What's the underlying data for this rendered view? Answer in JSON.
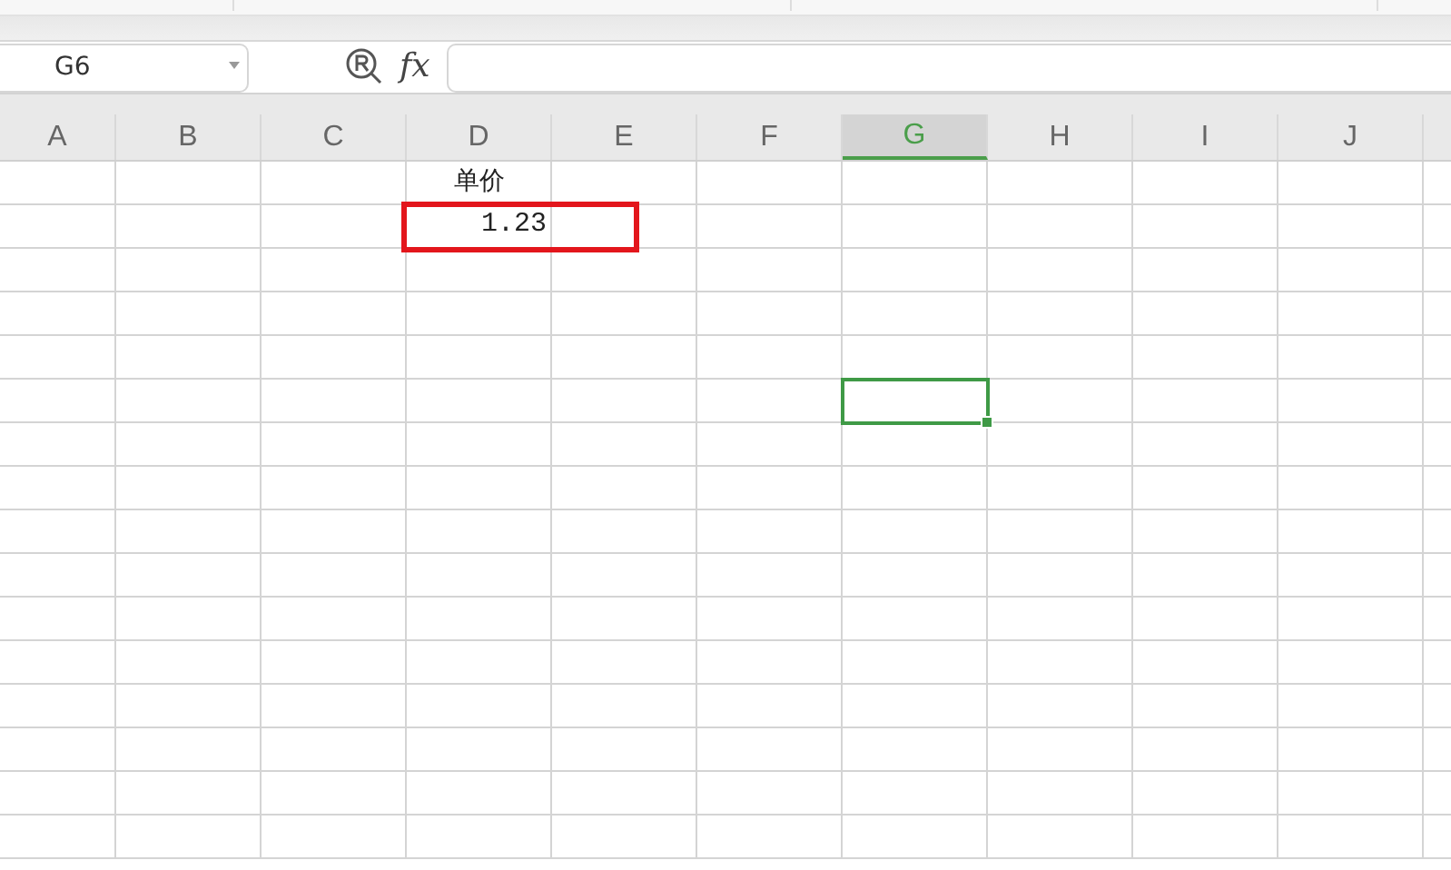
{
  "name_box": {
    "value": "G6"
  },
  "formula_bar": {
    "function_label": "fx"
  },
  "columns": [
    {
      "label": "A",
      "selected": false
    },
    {
      "label": "B",
      "selected": false
    },
    {
      "label": "C",
      "selected": false
    },
    {
      "label": "D",
      "selected": false
    },
    {
      "label": "E",
      "selected": false
    },
    {
      "label": "F",
      "selected": false
    },
    {
      "label": "G",
      "selected": true
    },
    {
      "label": "H",
      "selected": false
    },
    {
      "label": "I",
      "selected": false
    },
    {
      "label": "J",
      "selected": false
    }
  ],
  "rows": [
    {
      "cells": [
        null,
        null,
        null,
        {
          "text": "单价",
          "kind": "text"
        }
      ]
    },
    {
      "cells": [
        null,
        null,
        null,
        {
          "text": "1.23",
          "kind": "number",
          "highlighted": true
        }
      ]
    },
    {},
    {},
    {},
    {
      "cells": [
        null,
        null,
        null,
        null,
        null,
        null,
        {
          "selected": true
        }
      ]
    },
    {},
    {},
    {},
    {},
    {},
    {},
    {},
    {},
    {},
    {}
  ]
}
